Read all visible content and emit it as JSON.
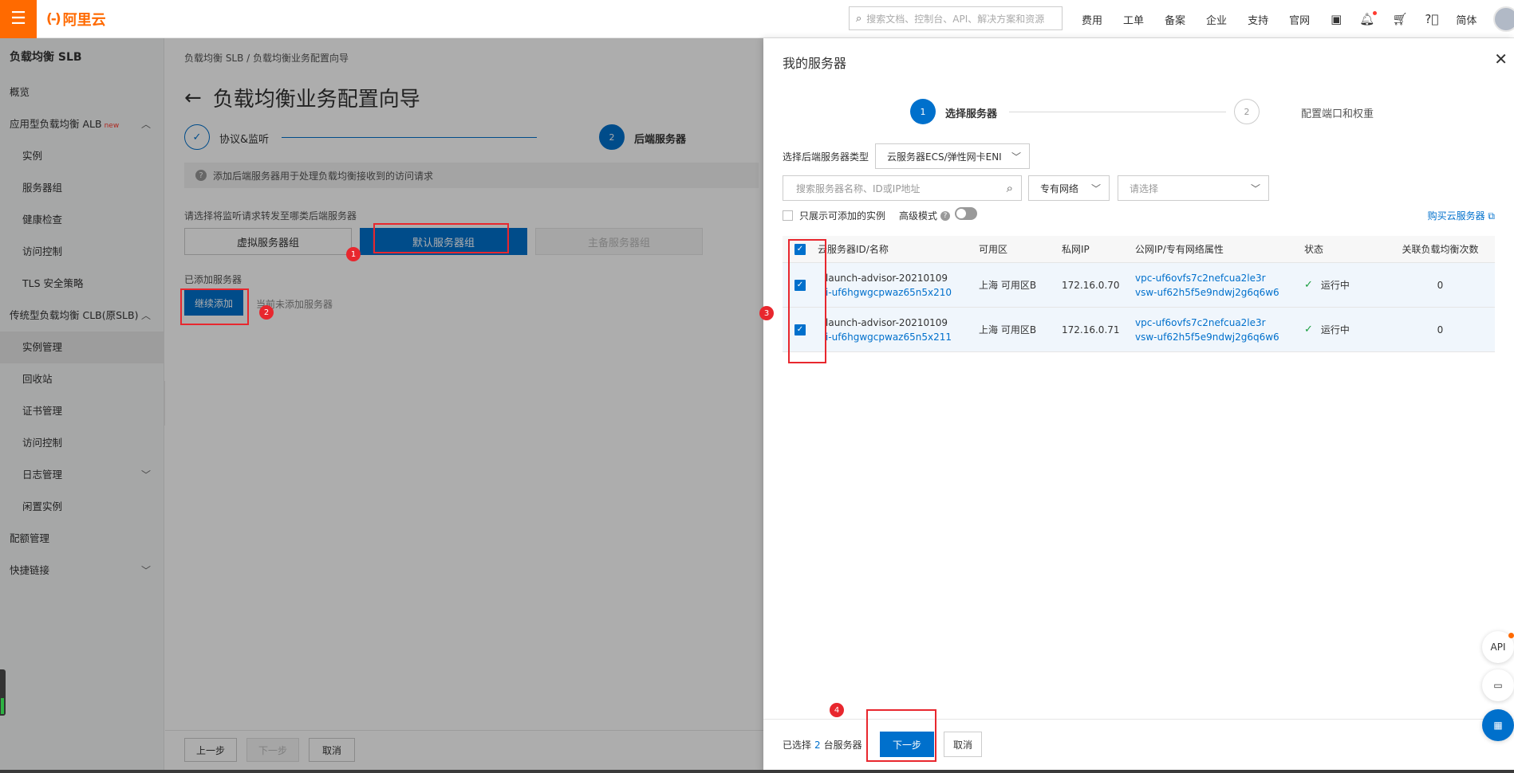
{
  "topbar": {
    "logo_text": "阿里云",
    "search_placeholder": "搜索文档、控制台、API、解决方案和资源",
    "nav": [
      "费用",
      "工单",
      "备案",
      "企业",
      "支持",
      "官网"
    ],
    "lang": "简体"
  },
  "sidebar": {
    "title": "负载均衡 SLB",
    "items": [
      {
        "label": "概览"
      },
      {
        "label": "应用型负载均衡 ALB",
        "badge": "new"
      },
      {
        "label": "实例"
      },
      {
        "label": "服务器组"
      },
      {
        "label": "健康检查"
      },
      {
        "label": "访问控制"
      },
      {
        "label": "TLS 安全策略"
      },
      {
        "label": "传统型负载均衡 CLB(原SLB)"
      },
      {
        "label": "实例管理"
      },
      {
        "label": "回收站"
      },
      {
        "label": "证书管理"
      },
      {
        "label": "访问控制"
      },
      {
        "label": "日志管理"
      },
      {
        "label": "闲置实例"
      },
      {
        "label": "配额管理"
      },
      {
        "label": "快捷链接"
      }
    ]
  },
  "main": {
    "breadcrumb": "负载均衡 SLB  /  负载均衡业务配置向导",
    "title": "负载均衡业务配置向导",
    "steps": [
      {
        "label": "协议&监听",
        "num": "✓"
      },
      {
        "label": "后端服务器",
        "num": "2"
      }
    ],
    "tip": "添加后端服务器用于处理负载均衡接收到的访问请求",
    "choose_label": "请选择将监听请求转发至哪类后端服务器",
    "groups": [
      "虚拟服务器组",
      "默认服务器组",
      "主备服务器组"
    ],
    "added_label": "已添加服务器",
    "continue_btn": "继续添加",
    "none_text": "当前未添加服务器",
    "footer": {
      "prev": "上一步",
      "next": "下一步",
      "cancel": "取消"
    }
  },
  "drawer": {
    "title": "我的服务器",
    "steps": [
      {
        "num": "1",
        "label": "选择服务器"
      },
      {
        "num": "2",
        "label": "配置端口和权重"
      }
    ],
    "type_label": "选择后端服务器类型",
    "type_value": "云服务器ECS/弹性网卡ENI",
    "search_placeholder": "搜索服务器名称、ID或IP地址",
    "network_value": "专有网络",
    "select_placeholder": "请选择",
    "only_show_label": "只展示可添加的实例",
    "advanced_label": "高级模式",
    "buy_link": "购买云服务器",
    "columns": [
      "云服务器ID/名称",
      "可用区",
      "私网IP",
      "公网IP/专有网络属性",
      "状态",
      "关联负载均衡次数"
    ],
    "rows": [
      {
        "name": "launch-advisor-20210109",
        "id": "i-uf6hgwgcpwaz65n5x210",
        "zone": "上海 可用区B",
        "ip": "172.16.0.70",
        "vpc": "vpc-uf6ovfs7c2nefcua2le3r",
        "vsw": "vsw-uf62h5f5e9ndwj2g6q6w6",
        "status": "运行中",
        "count": "0"
      },
      {
        "name": "launch-advisor-20210109",
        "id": "i-uf6hgwgcpwaz65n5x211",
        "zone": "上海 可用区B",
        "ip": "172.16.0.71",
        "vpc": "vpc-uf6ovfs7c2nefcua2le3r",
        "vsw": "vsw-uf62h5f5e9ndwj2g6q6w6",
        "status": "运行中",
        "count": "0"
      }
    ],
    "footer": {
      "selected_prefix": "已选择",
      "selected_count": "2",
      "selected_suffix": "台服务器",
      "next": "下一步",
      "cancel": "取消"
    }
  },
  "annotations": [
    "1",
    "2",
    "3",
    "4"
  ],
  "floating": {
    "api": "API"
  },
  "colors": {
    "brand": "#ff6a00",
    "primary": "#0070cc",
    "annotation": "#e8272e"
  }
}
